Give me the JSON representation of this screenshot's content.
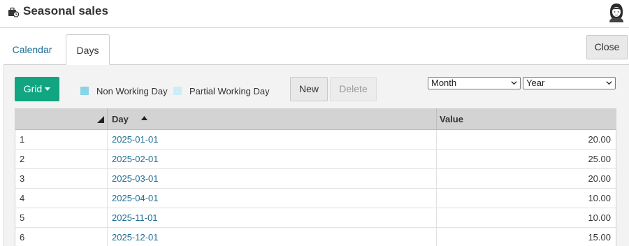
{
  "header": {
    "title": "Seasonal sales",
    "app_icon": "briefcase-clock-icon",
    "avatar_icon": "user-avatar-icon"
  },
  "tabs": [
    {
      "label": "Calendar",
      "active": false
    },
    {
      "label": "Days",
      "active": true
    }
  ],
  "close_label": "Close",
  "toolbar": {
    "grid_label": "Grid",
    "new_label": "New",
    "delete_label": "Delete",
    "delete_enabled": false
  },
  "legend": {
    "non_working": {
      "label": "Non Working Day",
      "color": "#89d4e6"
    },
    "partial_working": {
      "label": "Partial Working Day",
      "color": "#cdedf5"
    }
  },
  "filters": {
    "month": {
      "value": "Month"
    },
    "year": {
      "value": "Year"
    }
  },
  "table": {
    "columns": [
      "",
      "Day",
      "Value"
    ],
    "sort": {
      "column": "Day",
      "direction": "ascending"
    },
    "rows": [
      {
        "index": "1",
        "day": "2025-01-01",
        "value": "20.00"
      },
      {
        "index": "2",
        "day": "2025-02-01",
        "value": "25.00"
      },
      {
        "index": "3",
        "day": "2025-03-01",
        "value": "20.00"
      },
      {
        "index": "4",
        "day": "2025-04-01",
        "value": "10.00"
      },
      {
        "index": "5",
        "day": "2025-11-01",
        "value": "10.00"
      },
      {
        "index": "6",
        "day": "2025-12-01",
        "value": "15.00"
      }
    ]
  },
  "colors": {
    "accent": "#11a581",
    "link": "#1f6f95",
    "header_bg": "#d3d3d3"
  }
}
